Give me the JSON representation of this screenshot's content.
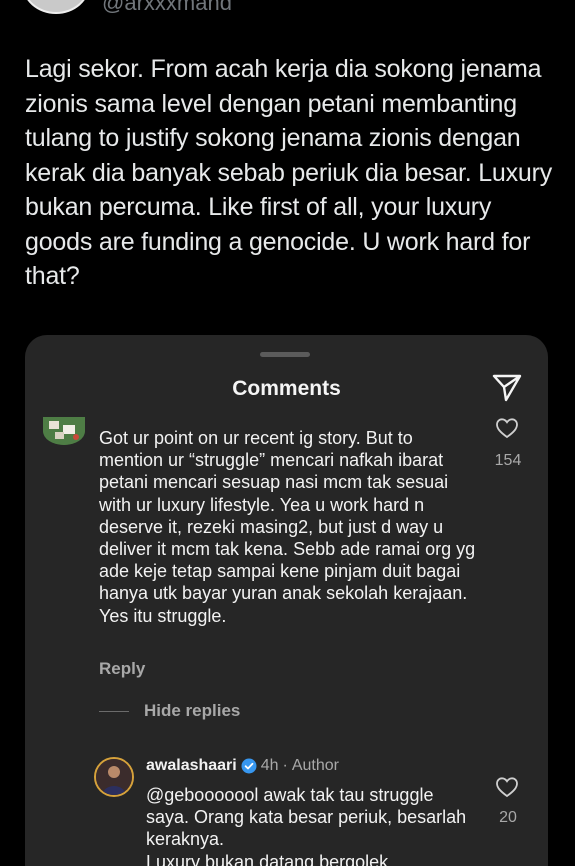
{
  "tweet": {
    "handle": "@arxxxmand",
    "text": "Lagi sekor. From acah kerja dia sokong jenama zionis sama level dengan petani membanting tulang to justify sokong jenama zionis dengan kerak dia banyak sebab periuk dia besar. Luxury bukan percuma. Like first of all, your luxury goods are funding a genocide. U work hard for that?"
  },
  "screenshot": {
    "title": "Comments",
    "comment": {
      "text": "Got ur point on ur recent ig story. But to mention ur “struggle” mencari nafkah ibarat petani mencari sesuap nasi mcm tak sesuai with ur luxury lifestyle. Yea u work hard n deserve it, rezeki masing2, but just d way u deliver it mcm tak kena. Sebb ade ramai org yg ade keje tetap sampai kene pinjam duit bagai hanya utk bayar yuran anak sekolah kerajaan. Yes itu struggle.",
      "likes": "154",
      "reply_label": "Reply",
      "hide_replies_label": "Hide replies"
    },
    "reply": {
      "username": "awalashaari",
      "time": "4h",
      "separator": "·",
      "role": "Author",
      "text": "@gebooooool awak tak tau struggle saya. Orang kata besar periuk, besarlah keraknya.",
      "text_cont": "Luxury bukan datang bergolek",
      "likes": "20"
    }
  },
  "colors": {
    "background": "#000000",
    "panel": "#262626",
    "verified": "#3797f0",
    "avatar_ring": "#d6a23b"
  },
  "icons": [
    "send-icon",
    "heart-outline-icon",
    "verified-badge-icon"
  ]
}
